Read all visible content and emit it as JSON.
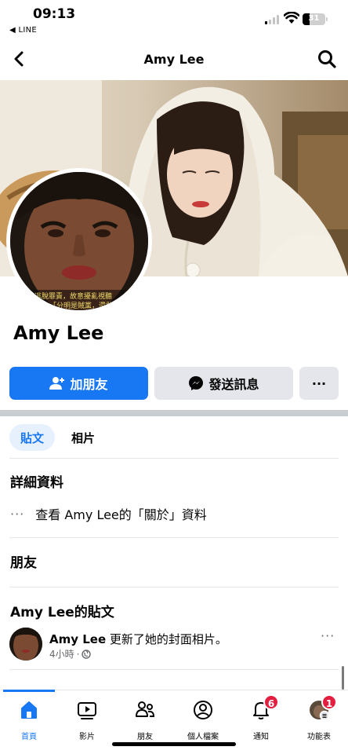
{
  "status_bar": {
    "time": "09:13",
    "back_app": "◀ LINE",
    "battery": "31",
    "battery_level": 0.31
  },
  "header": {
    "title": "Amy Lee"
  },
  "profile": {
    "name": "Amy Lee",
    "avatar_caption_1": "了逃脫罪責，故意擾亂視聽",
    "avatar_caption_2": "「分明是賊黨，還敢"
  },
  "actions": {
    "add_friend": "加朋友",
    "send_message": "發送訊息",
    "more": "···"
  },
  "tabs": [
    {
      "label": "貼文",
      "active": true
    },
    {
      "label": "相片",
      "active": false
    }
  ],
  "about": {
    "title": "詳細資料",
    "dots": "···",
    "link": "查看 Amy Lee的「關於」資料"
  },
  "friends": {
    "title": "朋友"
  },
  "posts": {
    "title": "Amy Lee的貼文",
    "items": [
      {
        "author": "Amy Lee",
        "action": " 更新了她的封面相片。",
        "time": "4小時",
        "dot": "·",
        "more": "···"
      }
    ]
  },
  "bottom_nav": [
    {
      "label": "首頁",
      "icon": "home-icon",
      "active": true
    },
    {
      "label": "影片",
      "icon": "video-icon",
      "active": false
    },
    {
      "label": "朋友",
      "icon": "friends-icon",
      "active": false
    },
    {
      "label": "個人檔案",
      "icon": "profile-icon",
      "active": false
    },
    {
      "label": "通知",
      "icon": "bell-icon",
      "active": false,
      "badge": "6"
    },
    {
      "label": "功能表",
      "icon": "menu-icon",
      "active": false,
      "badge": "1"
    }
  ],
  "colors": {
    "accent": "#1877f2",
    "badge": "#e41e3f",
    "button_grey": "#e4e6eb"
  }
}
